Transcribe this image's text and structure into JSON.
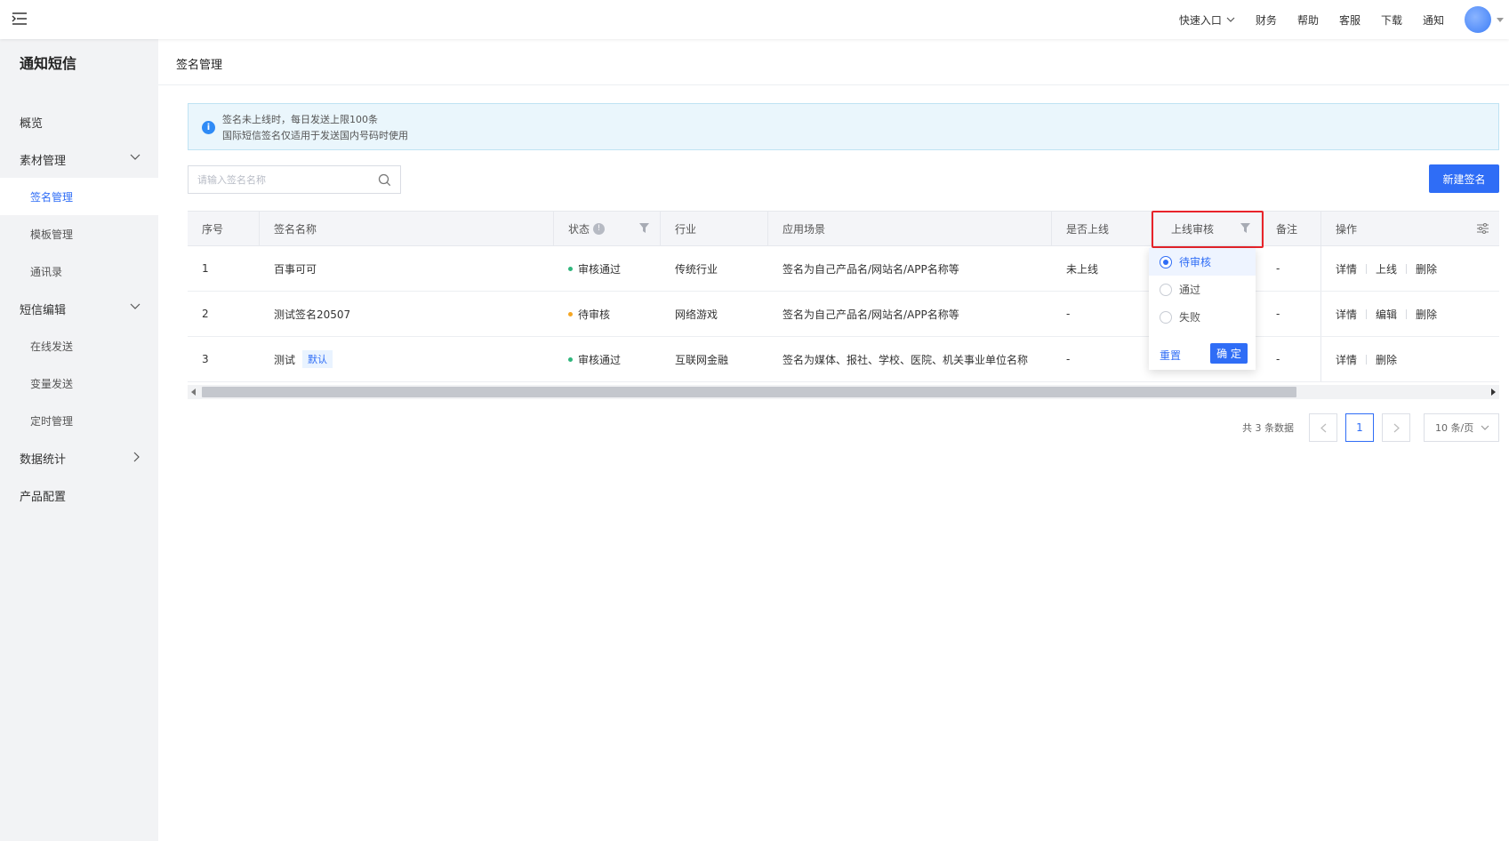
{
  "topbar": {
    "quick_entry": "快速入口",
    "links": [
      "财务",
      "帮助",
      "客服",
      "下载",
      "通知"
    ]
  },
  "sidebar": {
    "title": "通知短信",
    "overview": "概览",
    "material": {
      "label": "素材管理",
      "children": [
        "签名管理",
        "模板管理",
        "通讯录"
      ]
    },
    "sms_edit": {
      "label": "短信编辑",
      "children": [
        "在线发送",
        "变量发送",
        "定时管理"
      ]
    },
    "stats": "数据统计",
    "product": "产品配置"
  },
  "page": {
    "title": "签名管理"
  },
  "notice": {
    "line1": "签名未上线时，每日发送上限100条",
    "line2": "国际短信签名仅适用于发送国内号码时使用"
  },
  "search": {
    "placeholder": "请输入签名名称"
  },
  "new_button": "新建签名",
  "table": {
    "headers": {
      "index": "序号",
      "name": "签名名称",
      "status": "状态",
      "industry": "行业",
      "scene": "应用场景",
      "online": "是否上线",
      "review": "上线审核",
      "remark": "备注",
      "ops": "操作"
    },
    "rows": [
      {
        "index": "1",
        "name": "百事可可",
        "tag": "",
        "status": "审核通过",
        "industry": "传统行业",
        "scene": "签名为自己产品名/网站名/APP名称等",
        "online": "未上线",
        "remark": "-",
        "ops": [
          "详情",
          "上线",
          "删除"
        ]
      },
      {
        "index": "2",
        "name": "测试签名20507",
        "tag": "",
        "status": "待审核",
        "industry": "网络游戏",
        "scene": "签名为自己产品名/网站名/APP名称等",
        "online": "-",
        "remark": "-",
        "ops": [
          "详情",
          "编辑",
          "删除"
        ]
      },
      {
        "index": "3",
        "name": "测试",
        "tag": "默认",
        "status": "审核通过",
        "industry": "互联网金融",
        "scene": "签名为媒体、报社、学校、医院、机关事业单位名称",
        "online": "-",
        "remark": "-",
        "ops": [
          "详情",
          "删除"
        ]
      }
    ]
  },
  "filter_dropdown": {
    "options": [
      "待审核",
      "通过",
      "失败"
    ],
    "selected": "待审核",
    "reset": "重置",
    "confirm": "确 定"
  },
  "pagination": {
    "total": "共 3 条数据",
    "current": "1",
    "page_size": "10 条/页"
  },
  "colors": {
    "primary": "#2f6df6",
    "approved": "#2fb67c",
    "pending": "#f5a623",
    "highlight": "#e8242a"
  }
}
